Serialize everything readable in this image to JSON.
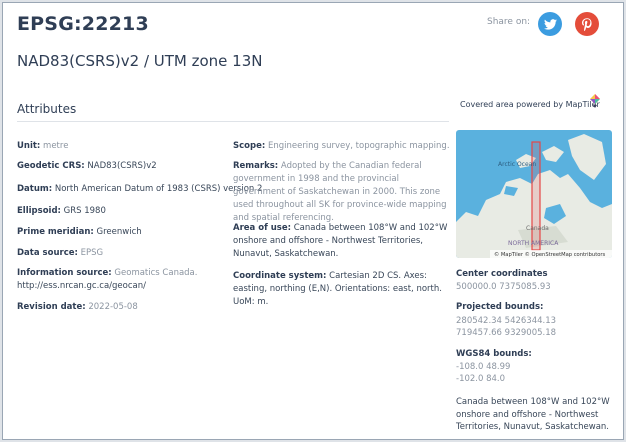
{
  "header": {
    "title": "EPSG:22213",
    "subtitle": "NAD83(CSRS)v2 / UTM zone 13N",
    "share_label": "Share on:"
  },
  "icons": {
    "twitter": "twitter-icon",
    "pinterest": "pinterest-icon",
    "maptiler": "maptiler-logo-icon"
  },
  "colors": {
    "twitter": "#3b9ce0",
    "pinterest": "#e44d3a",
    "title": "#2f3e55",
    "muted": "#8b94a0",
    "map_water": "#5ab1de",
    "map_land": "#e8ebe4"
  },
  "attributes": {
    "heading": "Attributes",
    "unit": {
      "label": "Unit:",
      "value": "metre"
    },
    "geodetic_crs": {
      "label": "Geodetic CRS:",
      "value": "NAD83(CSRS)v2"
    },
    "datum": {
      "label": "Datum:",
      "value": "North American Datum of 1983 (CSRS) version 2"
    },
    "ellipsoid": {
      "label": "Ellipsoid:",
      "value": "GRS 1980"
    },
    "prime_meridian": {
      "label": "Prime meridian:",
      "value": "Greenwich"
    },
    "data_source": {
      "label": "Data source:",
      "value": "EPSG"
    },
    "information_source": {
      "label": "Information source:",
      "value": "Geomatics Canada.",
      "url": "http://ess.nrcan.gc.ca/geocan/"
    },
    "revision_date": {
      "label": "Revision date:",
      "value": "2022-05-08"
    },
    "scope": {
      "label": "Scope:",
      "value": "Engineering survey, topographic mapping."
    },
    "remarks": {
      "label": "Remarks:",
      "value": "Adopted by the Canadian federal government in 1998 and the provincial government of Saskatchewan in 2000. This zone used throughout all SK for province-wide mapping and spatial referencing."
    },
    "area_of_use": {
      "label": "Area of use:",
      "value": "Canada between 108°W and 102°W onshore and offshore - Northwest Territories, Nunavut, Saskatchewan."
    },
    "coordinate_system": {
      "label": "Coordinate system:",
      "value": "Cartesian 2D CS. Axes: easting, northing (E,N). Orientations: east, north. UoM: m."
    }
  },
  "map": {
    "covered_label": "Covered area powered by MapTiler",
    "labels": {
      "ocean": "Arctic Ocean",
      "canada": "Canada",
      "continent": "NORTH AMERICA"
    },
    "attribution": "© MapTiler © OpenStreetMap contributors",
    "center_label": "Center coordinates",
    "center_value": "500000.0 7375085.93",
    "projected_label": "Projected bounds:",
    "projected_line1": "280542.34 5426344.13",
    "projected_line2": "719457.66 9329005.18",
    "wgs84_label": "WGS84 bounds:",
    "wgs84_line1": "-108.0 48.99",
    "wgs84_line2": "-102.0 84.0",
    "area_summary": "Canada between 108°W and 102°W onshore and offshore - Northwest Territories, Nunavut, Saskatchewan."
  }
}
